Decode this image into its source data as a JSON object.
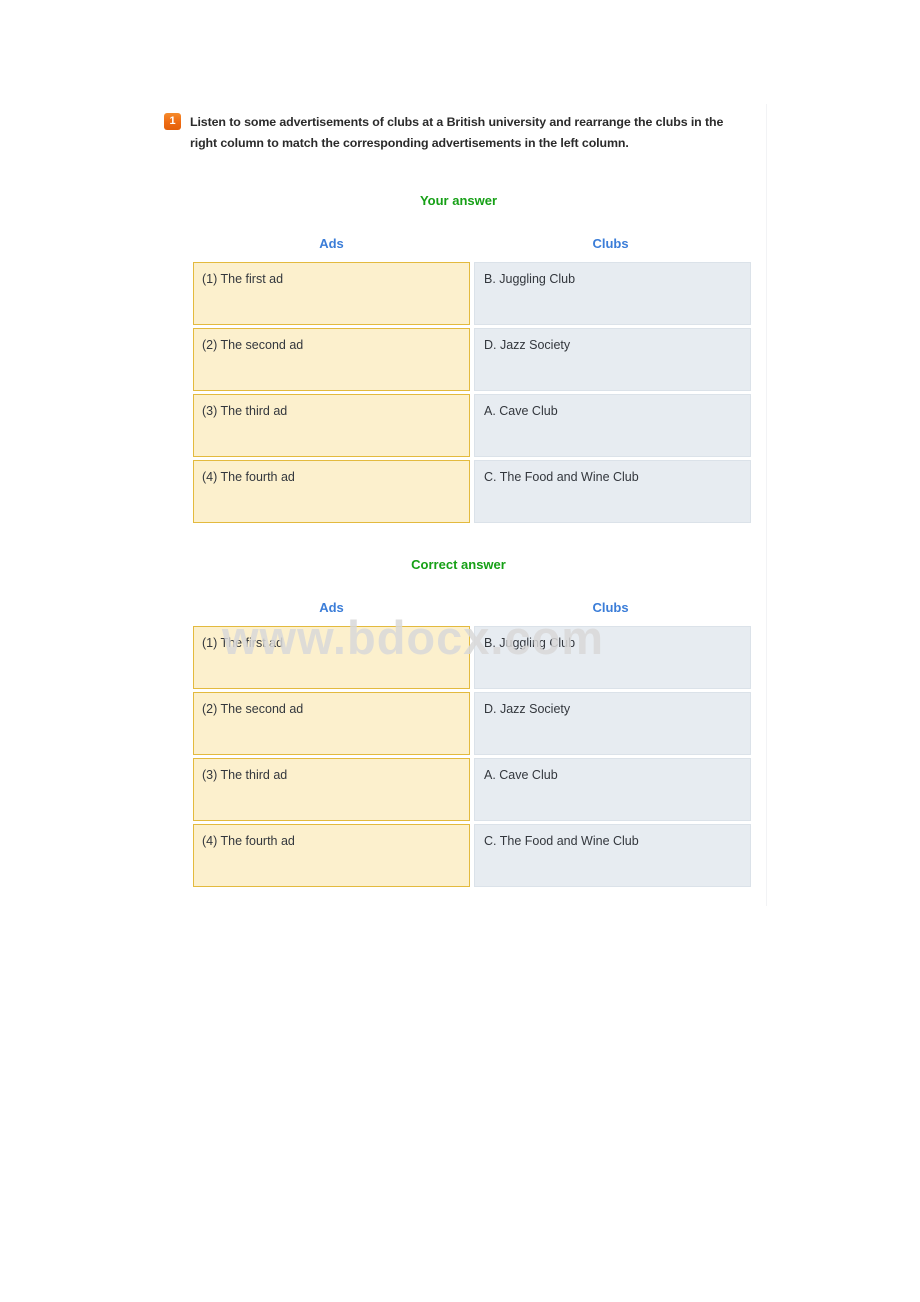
{
  "question": {
    "number": "1",
    "text": "Listen to some advertisements of clubs at a British university and rearrange the clubs in the right column to match the corresponding advertisements in the left column."
  },
  "sections": [
    {
      "heading": "Your answer",
      "columns": {
        "left": "Ads",
        "right": "Clubs"
      },
      "rows": [
        {
          "ad": "(1) The first ad",
          "club": "B. Juggling Club"
        },
        {
          "ad": "(2) The second ad",
          "club": "D. Jazz Society"
        },
        {
          "ad": "(3) The third ad",
          "club": "A. Cave Club"
        },
        {
          "ad": "(4) The fourth ad",
          "club": "C. The Food and Wine Club"
        }
      ]
    },
    {
      "heading": "Correct answer",
      "columns": {
        "left": "Ads",
        "right": "Clubs"
      },
      "rows": [
        {
          "ad": "(1) The first ad",
          "club": "B. Juggling Club"
        },
        {
          "ad": "(2) The second ad",
          "club": "D. Jazz Society"
        },
        {
          "ad": "(3) The third ad",
          "club": "A. Cave Club"
        },
        {
          "ad": "(4) The fourth ad",
          "club": "C. The Food and Wine Club"
        }
      ]
    }
  ],
  "watermark": {
    "text": "www.bdocx.com"
  },
  "colors": {
    "badge_orange": "#ef6c13",
    "heading_green": "#16a016",
    "column_header_blue": "#3b7dd8",
    "ad_cell_bg": "#fcf0cd",
    "ad_cell_border": "#e3ba3e",
    "club_cell_bg": "#e7ecf1",
    "club_cell_border": "#dbe2e9",
    "text_dark": "#33373d",
    "watermark_gray": "#d9d9d9"
  }
}
